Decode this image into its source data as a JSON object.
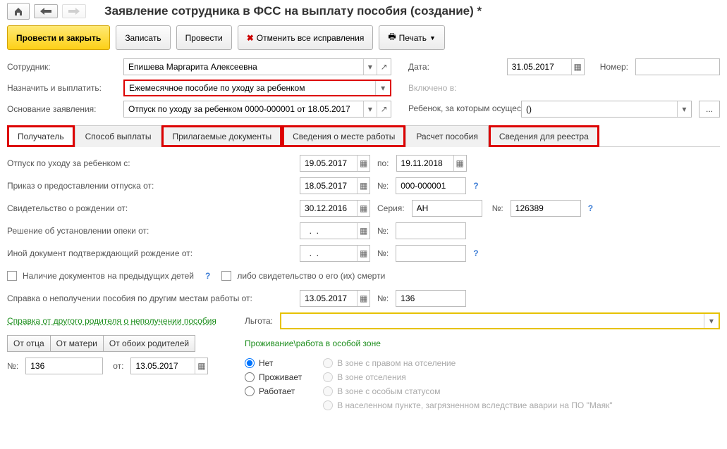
{
  "title": "Заявление сотрудника в ФСС на выплату пособия (создание) *",
  "actions": {
    "postClose": "Провести и закрыть",
    "write": "Записать",
    "post": "Провести",
    "cancelAll": "Отменить все исправления",
    "print": "Печать"
  },
  "labels": {
    "employee": "Сотрудник:",
    "date": "Дата:",
    "number": "Номер:",
    "assignPay": "Назначить и выплатить:",
    "includedIn": "Включено в:",
    "basis": "Основание заявления:",
    "childCaredBy": "Ребенок, за которым осуществляется уход:",
    "leaveFrom": "Отпуск по уходу за ребенком с:",
    "to": "по:",
    "orderFrom": "Приказ о предоставлении отпуска от:",
    "num": "№:",
    "birthCertFrom": "Свидетельство о рождении от:",
    "series": "Серия:",
    "guardianFrom": "Решение об установлении опеки от:",
    "otherDocFrom": "Иной документ подтверждающий рождение от:",
    "prevKidsDocs": "Наличие документов на предыдущих детей",
    "orDeath": "либо свидетельство о его (их) смерти",
    "nonReceiptFrom": "Справка о неполучении пособия по другим местам работы от:",
    "otherParentNonReceipt": "Справка от другого родителя о неполучении пособия",
    "fromFather": "От отца",
    "fromMother": "От матери",
    "fromBoth": "От обоих родителей",
    "from": "от:",
    "benefit": "Льгота:",
    "zoneHeader": "Проживание\\работа в особой зоне",
    "zNone": "Нет",
    "zLives": "Проживает",
    "zWorks": "Работает",
    "zResettle": "В зоне с правом на отселение",
    "zOt": "В зоне отселения",
    "zStatus": "В зоне с особым статусом",
    "zMayak": "В населенном пункте, загрязненном вследствие аварии на ПО \"Маяк\""
  },
  "tabs": {
    "t1": "Получатель",
    "t2": "Способ выплаты",
    "t3": "Прилагаемые документы",
    "t4": "Сведения о месте работы",
    "t5": "Расчет пособия",
    "t6": "Сведения для реестра"
  },
  "values": {
    "employee": "Епишева Маргарита Алексеевна",
    "date": "31.05.2017",
    "number": "",
    "assignPay": "Ежемесячное пособие по уходу за ребенком",
    "basis": "Отпуск по уходу за ребенком 0000-000001 от 18.05.2017",
    "childCared": "()",
    "leaveFrom": "19.05.2017",
    "leaveTo": "19.11.2018",
    "orderDate": "18.05.2017",
    "orderNum": "000-000001",
    "certDate": "30.12.2016",
    "certSeries": "АН",
    "certNum": "126389",
    "guardianDate": "  .  .    ",
    "guardianNum": "",
    "otherDate": "  .  .    ",
    "otherNum": "",
    "nonReceiptDate": "13.05.2017",
    "nonReceiptNum": "136",
    "sprNum": "136",
    "sprDate": "13.05.2017",
    "benefit": ""
  }
}
